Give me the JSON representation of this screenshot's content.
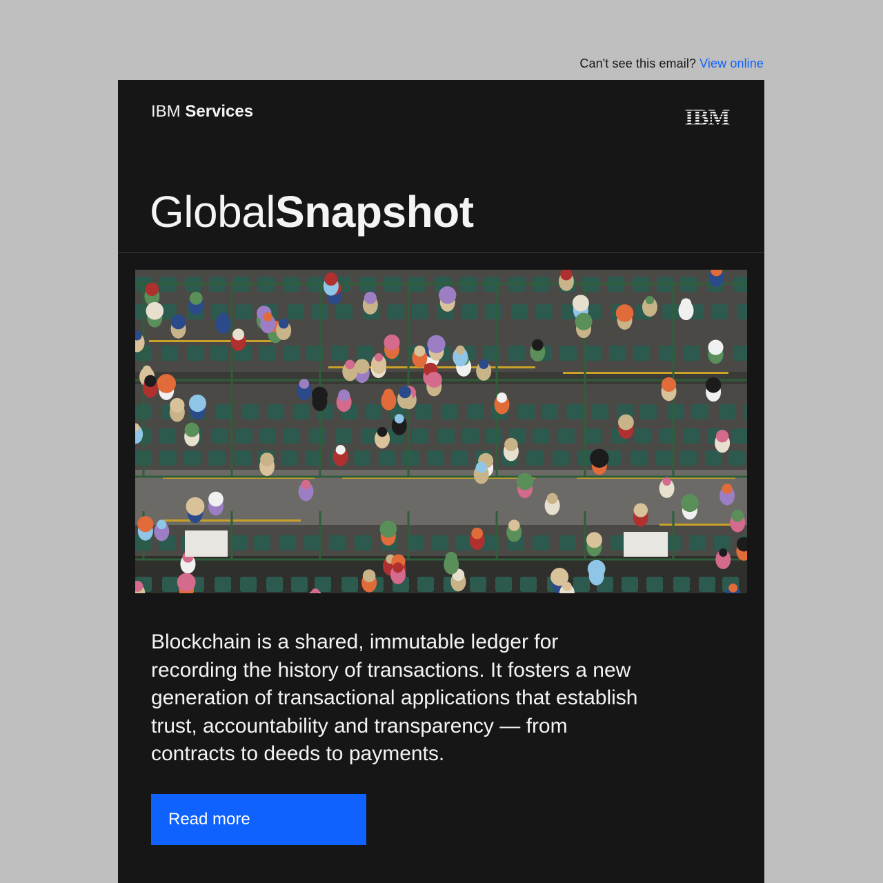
{
  "preheader": {
    "text": "Can't see this email?",
    "link_label": "View online"
  },
  "header": {
    "brand_regular": "IBM",
    "brand_bold": "Services",
    "logo_text": "IBM",
    "logo_icon": "ibm-striped-logo"
  },
  "hero": {
    "title_regular": "Global",
    "title_bold": "Snapshot",
    "image_icon": "aerial-stadium-crowd-photo"
  },
  "content": {
    "body": "Blockchain is a shared, immutable ledger for recording the history of transactions. It fosters a new generation of transactional applications that establish trust, accountability and transparency — from contracts to deeds to payments.",
    "cta_label": "Read more"
  },
  "colors": {
    "page_background": "#bfbfbf",
    "email_background": "#161616",
    "text_light": "#f4f4f4",
    "link_blue": "#0f62fe",
    "button_blue": "#0f62fe"
  }
}
